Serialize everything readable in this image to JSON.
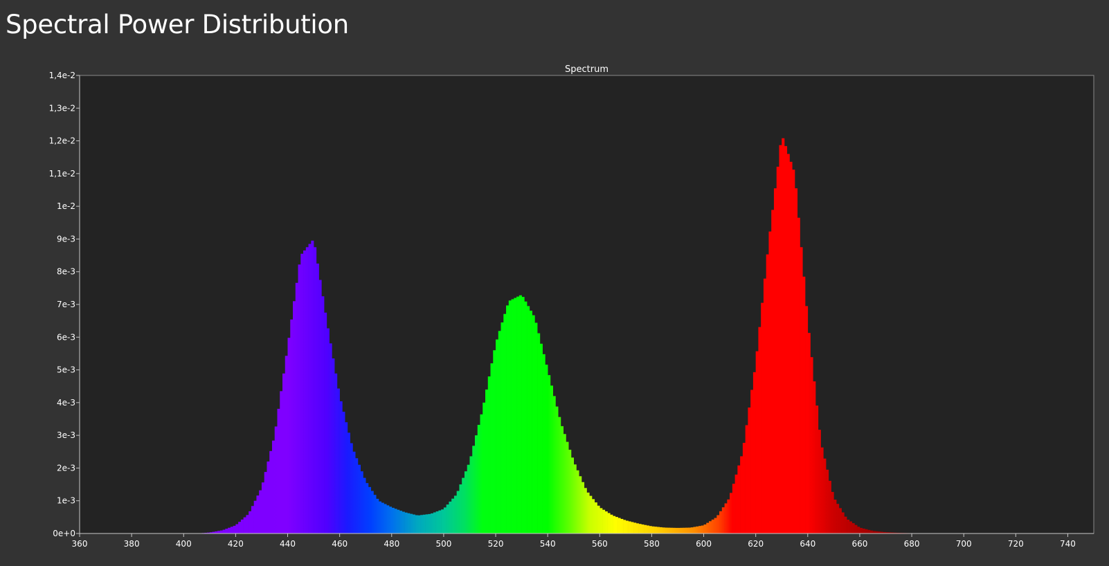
{
  "page": {
    "title": "Spectral Power Distribution"
  },
  "chart_data": {
    "type": "bar",
    "title": "Spectrum",
    "xlabel": "",
    "ylabel": "",
    "xlim": [
      360,
      750
    ],
    "ylim": [
      0,
      0.014
    ],
    "bin_width": 1,
    "grid": false,
    "legend": "none",
    "x_ticks": [
      360,
      380,
      400,
      420,
      440,
      460,
      480,
      500,
      520,
      540,
      560,
      580,
      600,
      620,
      640,
      660,
      680,
      700,
      720,
      740
    ],
    "x_tick_labels": [
      "360",
      "380",
      "400",
      "420",
      "440",
      "460",
      "480",
      "500",
      "520",
      "540",
      "560",
      "580",
      "600",
      "620",
      "640",
      "660",
      "680",
      "700",
      "720",
      "740"
    ],
    "y_ticks": [
      0,
      0.001,
      0.002,
      0.003,
      0.004,
      0.005,
      0.006,
      0.007,
      0.008,
      0.009,
      0.01,
      0.011,
      0.012,
      0.013,
      0.014
    ],
    "y_tick_labels": [
      "0e+0",
      "1e-3",
      "2e-3",
      "3e-3",
      "4e-3",
      "5e-3",
      "6e-3",
      "7e-3",
      "8e-3",
      "9e-3",
      "1e-2",
      "1,1e-2",
      "1,2e-2",
      "1,3e-2",
      "1,4e-2"
    ],
    "series": [
      {
        "x": [
          405,
          410,
          415,
          420,
          425,
          430,
          435,
          440,
          445,
          450,
          455,
          460,
          465,
          470,
          475,
          480,
          485,
          490,
          495,
          500,
          505,
          510,
          515,
          520,
          525,
          530,
          535,
          540,
          545,
          550,
          555,
          560,
          565,
          570,
          575,
          580,
          585,
          590,
          595,
          600,
          605,
          610,
          615,
          620,
          625,
          630,
          635,
          640,
          645,
          650,
          655,
          660,
          665,
          670,
          675,
          680,
          685,
          690,
          700,
          750
        ],
        "values": [
          0,
          3e-05,
          0.0001,
          0.00025,
          0.0006,
          0.0014,
          0.003,
          0.0057,
          0.0085,
          0.009,
          0.0065,
          0.0042,
          0.0026,
          0.0016,
          0.001,
          0.0008,
          0.00065,
          0.00055,
          0.0006,
          0.00075,
          0.0012,
          0.0022,
          0.0038,
          0.0058,
          0.0071,
          0.0073,
          0.0066,
          0.005,
          0.0034,
          0.0022,
          0.0013,
          0.0008,
          0.00055,
          0.0004,
          0.0003,
          0.00022,
          0.00018,
          0.00017,
          0.00018,
          0.00025,
          0.0005,
          0.0011,
          0.0025,
          0.0052,
          0.0089,
          0.0122,
          0.011,
          0.0065,
          0.0028,
          0.0011,
          0.00045,
          0.00018,
          8e-05,
          4e-05,
          2e-05,
          1e-05,
          5e-06,
          0,
          0,
          0
        ]
      }
    ]
  }
}
